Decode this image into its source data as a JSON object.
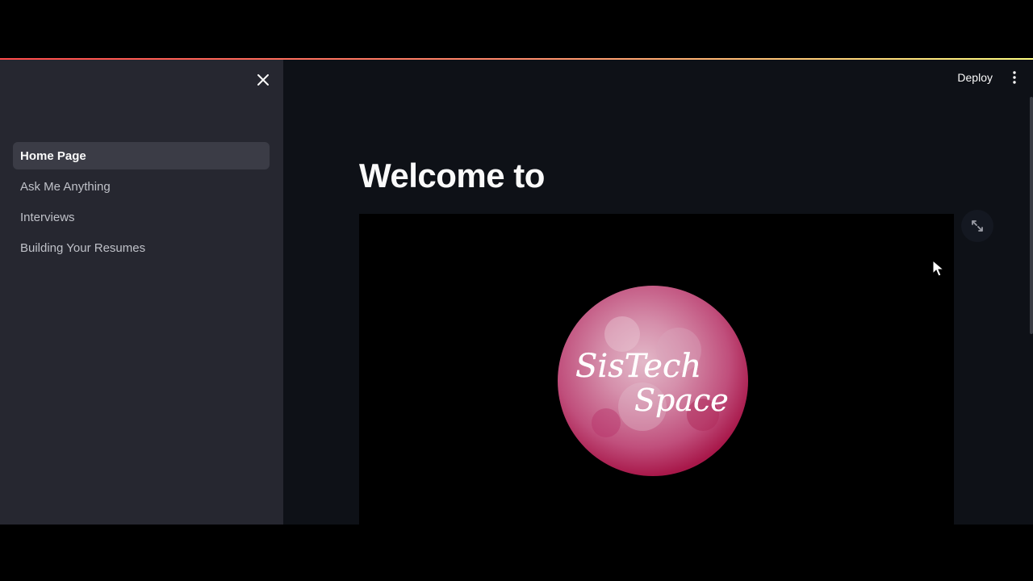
{
  "sidebar": {
    "close_icon": "close-icon",
    "items": [
      {
        "label": "Home Page",
        "active": true
      },
      {
        "label": "Ask Me Anything",
        "active": false
      },
      {
        "label": "Interviews",
        "active": false
      },
      {
        "label": "Building Your Resumes",
        "active": false
      }
    ]
  },
  "header": {
    "deploy_label": "Deploy",
    "menu_icon": "kebab-menu-icon"
  },
  "main": {
    "title": "Welcome to",
    "image": {
      "logo_line1": "SisTech",
      "logo_line2": "Space",
      "fullscreen_icon": "expand-icon"
    }
  },
  "colors": {
    "app_bg": "#0e1117",
    "sidebar_bg": "#262730",
    "active_item_bg": "#3b3c46",
    "accent_gradient_start": "#ff4b4b",
    "accent_gradient_end": "#fffd80",
    "logo_pink": "#c94f7c"
  }
}
